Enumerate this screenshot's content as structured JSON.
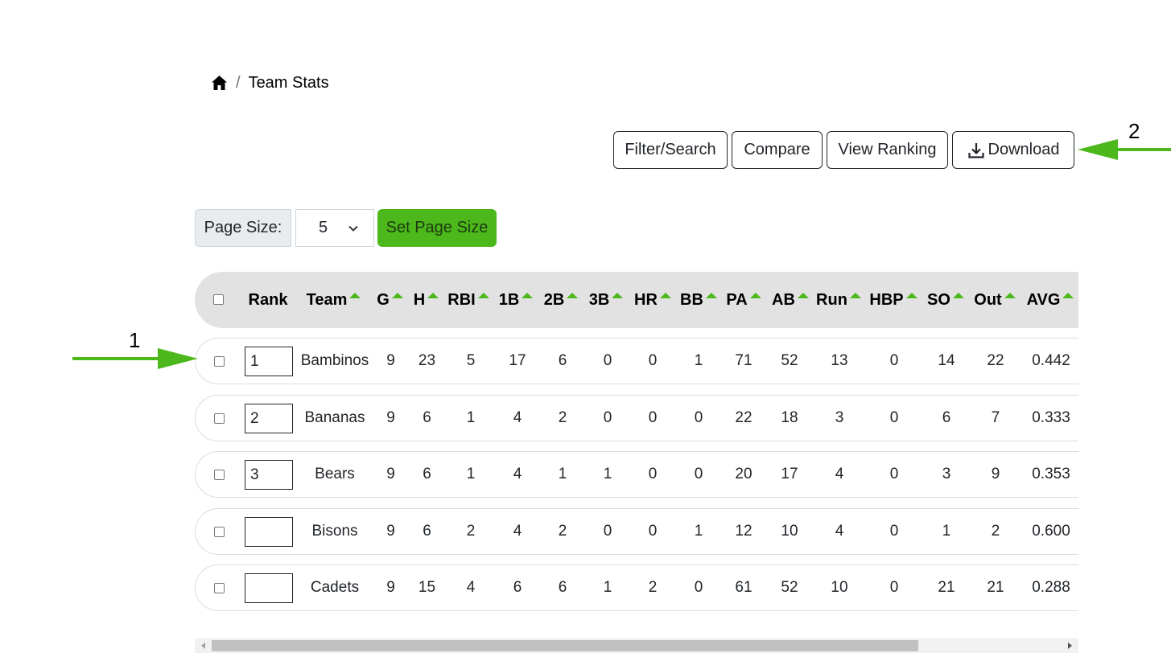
{
  "breadcrumb": {
    "home_icon": "home-icon",
    "separator": "/",
    "current": "Team Stats"
  },
  "toolbar": {
    "filter_label": "Filter/Search",
    "compare_label": "Compare",
    "ranking_label": "View Ranking",
    "download_label": "Download",
    "download_icon": "download-icon"
  },
  "page_size": {
    "label": "Page Size:",
    "selected": "5",
    "set_label": "Set Page Size"
  },
  "table": {
    "columns": [
      "Rank",
      "Team",
      "G",
      "H",
      "RBI",
      "1B",
      "2B",
      "3B",
      "HR",
      "BB",
      "PA",
      "AB",
      "Run",
      "HBP",
      "SO",
      "Out",
      "AVG"
    ],
    "sortable_indicator_color": "#4cb81c",
    "rows": [
      {
        "rank": "1",
        "cells": [
          "Bambinos",
          "9",
          "23",
          "5",
          "17",
          "6",
          "0",
          "0",
          "1",
          "71",
          "52",
          "13",
          "0",
          "14",
          "22",
          "0.442"
        ]
      },
      {
        "rank": "2",
        "cells": [
          "Bananas",
          "9",
          "6",
          "1",
          "4",
          "2",
          "0",
          "0",
          "0",
          "22",
          "18",
          "3",
          "0",
          "6",
          "7",
          "0.333"
        ]
      },
      {
        "rank": "3",
        "cells": [
          "Bears",
          "9",
          "6",
          "1",
          "4",
          "1",
          "1",
          "0",
          "0",
          "20",
          "17",
          "4",
          "0",
          "3",
          "9",
          "0.353"
        ]
      },
      {
        "rank": "",
        "cells": [
          "Bisons",
          "9",
          "6",
          "2",
          "4",
          "2",
          "0",
          "0",
          "1",
          "12",
          "10",
          "4",
          "0",
          "1",
          "2",
          "0.600"
        ]
      },
      {
        "rank": "",
        "cells": [
          "Cadets",
          "9",
          "15",
          "4",
          "6",
          "6",
          "1",
          "2",
          "0",
          "61",
          "52",
          "10",
          "0",
          "21",
          "21",
          "0.288"
        ]
      }
    ]
  },
  "annotations": {
    "label_1": "1",
    "label_2": "2",
    "arrow_color": "#4cb81c"
  },
  "colors": {
    "accent_green": "#4cb81c",
    "header_bg": "#e2e2e2"
  }
}
